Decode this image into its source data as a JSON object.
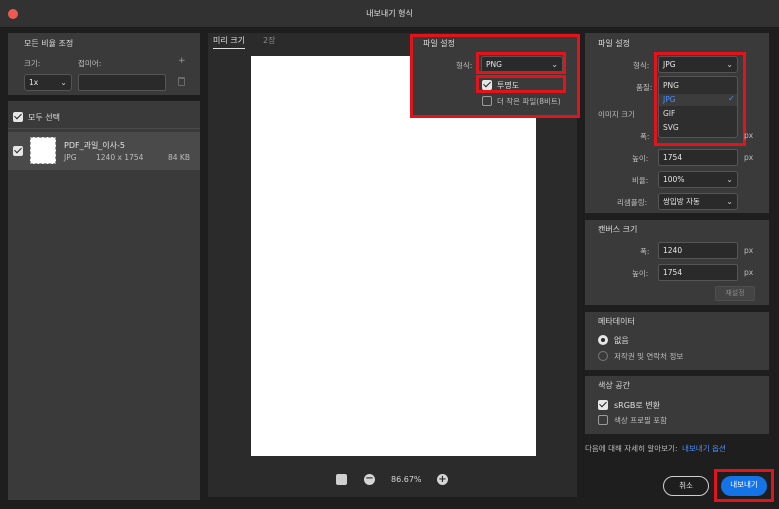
{
  "window": {
    "title": "내보내기 형식"
  },
  "left_panel": {
    "section_title": "모든 비율 조정",
    "col_size": "크기:",
    "col_suffix": "접미어:",
    "add_symbol": "+",
    "scale_value": "1x",
    "select_all_label": "모두 선택",
    "asset": {
      "name": "PDF_과일_이사-5",
      "format": "JPG",
      "dimensions": "1240 x 1754",
      "filesize": "84 KB"
    }
  },
  "preview": {
    "tabs": [
      "미리 크기",
      "2장"
    ],
    "zoom": "86.67%"
  },
  "popup_settings": {
    "section_title": "파일 설정",
    "format_label": "형식:",
    "format_value": "PNG",
    "transparency_label": "투명도",
    "smaller_file_label": "더 작은 파일(8비트)"
  },
  "file_settings": {
    "section_title": "파일 설정",
    "format_label": "형식:",
    "format_value": "JPG",
    "quality_label": "품질:",
    "dropdown_options": [
      "PNG",
      "JPG",
      "GIF",
      "SVG"
    ],
    "dropdown_selected": "JPG",
    "check_mark": "✓"
  },
  "image_size": {
    "section_title": "이미지 크기",
    "width_label": "폭:",
    "width_value": "1240",
    "height_label": "높이:",
    "height_value": "1754",
    "scale_label": "비율:",
    "scale_value": "100%",
    "resample_label": "리샘플링:",
    "resample_value": "쌍입방 자동",
    "unit": "px"
  },
  "canvas_size": {
    "section_title": "캔버스 크기",
    "width_label": "폭:",
    "width_value": "1240",
    "height_label": "높이:",
    "height_value": "1754",
    "unit": "px",
    "reset_label": "재설정"
  },
  "metadata": {
    "section_title": "메타데이터",
    "option_none": "없음",
    "option_copyright": "저작권 및 연락처 정보"
  },
  "color_space": {
    "section_title": "색상 공간",
    "convert_srgb": "sRGB로 변환",
    "embed_profile": "색상 프로필 포함"
  },
  "footer": {
    "learn_more_text": "다음에 대해 자세히 알아보기:",
    "learn_more_link": "내보내기 옵션",
    "cancel_label": "취소",
    "export_label": "내보내기"
  },
  "colors": {
    "accent": "#1473e6",
    "highlight": "#e2141b"
  }
}
